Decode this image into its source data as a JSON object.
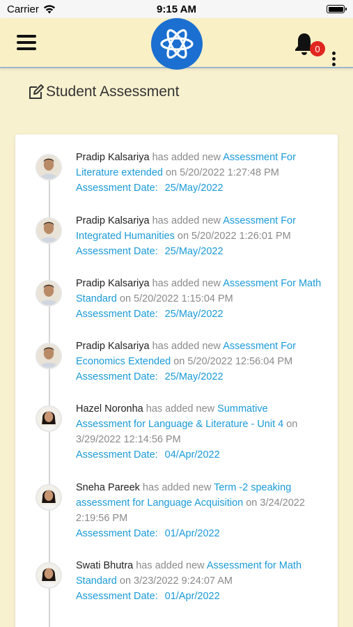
{
  "status_bar": {
    "carrier": "Carrier",
    "time": "9:15 AM"
  },
  "header": {
    "notification_count": "0",
    "logo_icon": "atom-logo-icon"
  },
  "page": {
    "title": "Student Assessment"
  },
  "entries": [
    {
      "name": "Pradip Kalsariya",
      "action": " has added new ",
      "assessment": "Assessment For Literature extended",
      "on": " on ",
      "timestamp": "5/20/2022 1:27:48 PM",
      "date_label": "Assessment Date:",
      "date": "25/May/2022",
      "avatar_gender": "male"
    },
    {
      "name": "Pradip Kalsariya",
      "action": " has added new ",
      "assessment": "Assessment For Integrated Humanities",
      "on": " on ",
      "timestamp": "5/20/2022 1:26:01 PM",
      "date_label": "Assessment Date:",
      "date": "25/May/2022",
      "avatar_gender": "male"
    },
    {
      "name": "Pradip Kalsariya",
      "action": " has added new ",
      "assessment": "Assessment For Math Standard",
      "on": " on ",
      "timestamp": "5/20/2022 1:15:04 PM",
      "date_label": "Assessment Date:",
      "date": "25/May/2022",
      "avatar_gender": "male"
    },
    {
      "name": "Pradip Kalsariya",
      "action": " has added new ",
      "assessment": "Assessment For Economics Extended",
      "on": " on ",
      "timestamp": "5/20/2022 12:56:04 PM",
      "date_label": "Assessment Date:",
      "date": "25/May/2022",
      "avatar_gender": "male"
    },
    {
      "name": "Hazel Noronha",
      "action": " has added new ",
      "assessment": "Summative Assessment for Language & Literature - Unit 4",
      "on": " on ",
      "timestamp": "3/29/2022 12:14:56 PM",
      "date_label": "Assessment Date:",
      "date": "04/Apr/2022",
      "avatar_gender": "female"
    },
    {
      "name": "Sneha Pareek",
      "action": " has added new ",
      "assessment": "Term -2 speaking assessment for Language Acquisition",
      "on": " on ",
      "timestamp": "3/24/2022 2:19:56 PM",
      "date_label": "Assessment Date:",
      "date": "01/Apr/2022",
      "avatar_gender": "female"
    },
    {
      "name": "Swati Bhutra",
      "action": " has added new ",
      "assessment": "Assessment for Math Standard",
      "on": " on ",
      "timestamp": "3/23/2022 9:24:07 AM",
      "date_label": "Assessment Date:",
      "date": "01/Apr/2022",
      "avatar_gender": "female"
    }
  ]
}
